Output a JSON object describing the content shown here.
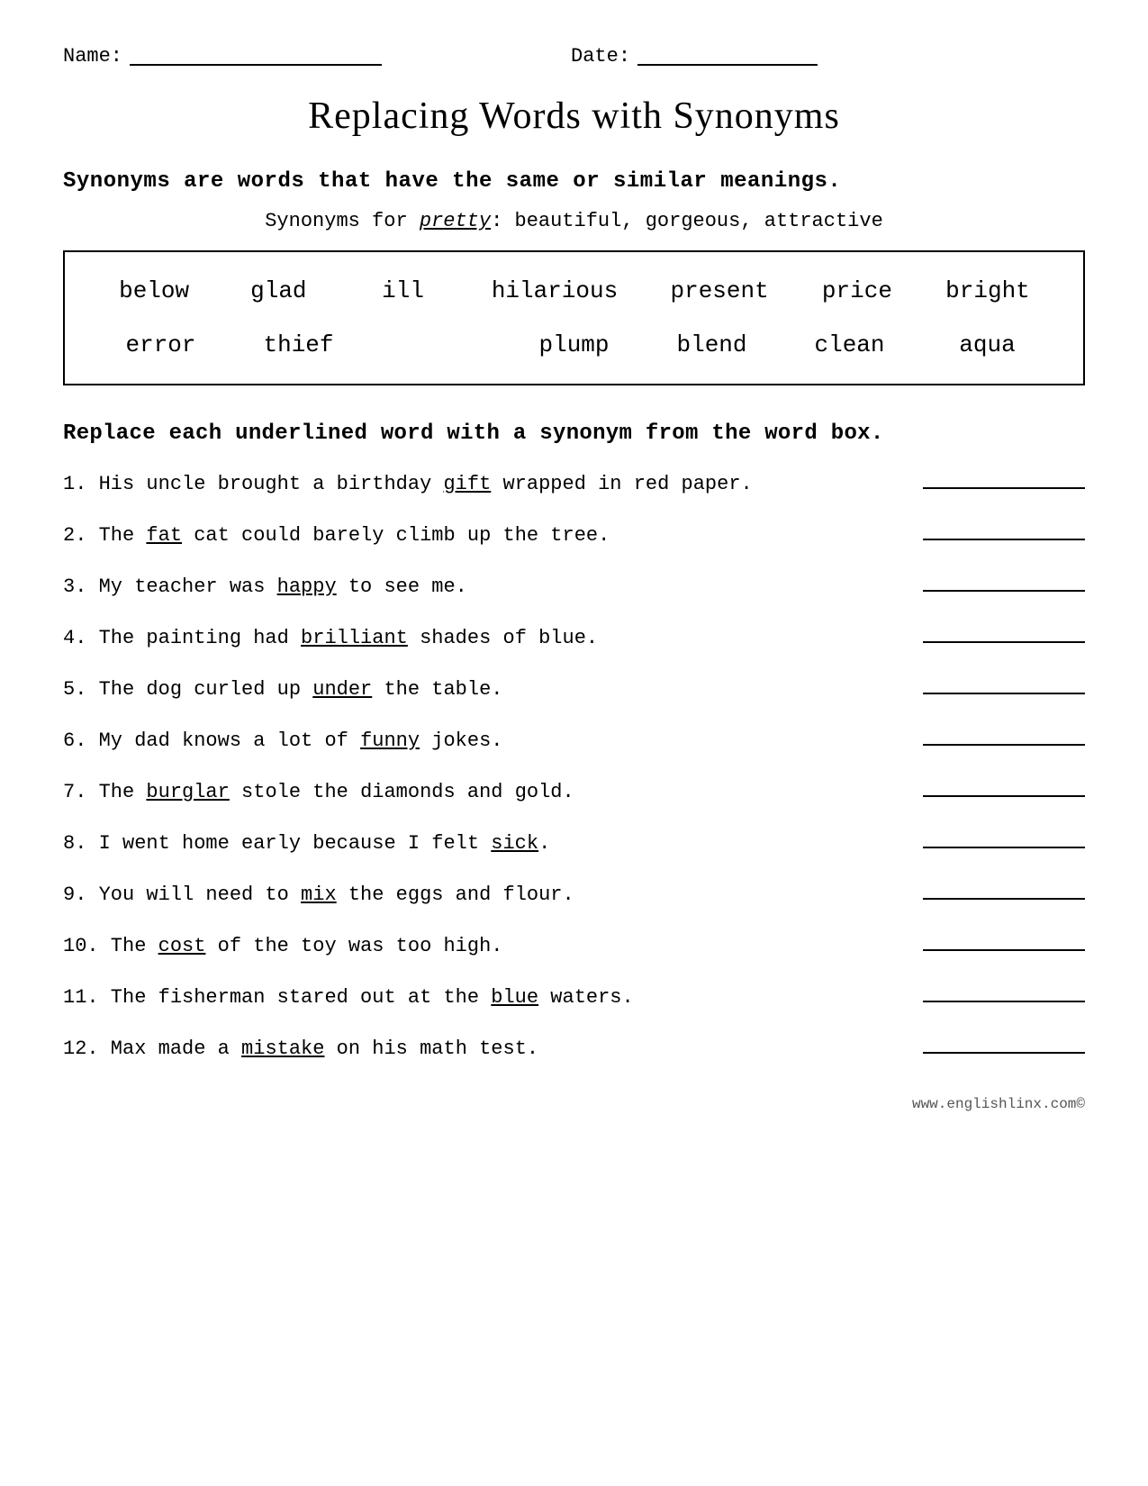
{
  "header": {
    "name_label": "Name:",
    "date_label": "Date:"
  },
  "title": "Replacing Words with Synonyms",
  "definition": {
    "text": "Synonyms are words that have the same or similar meanings."
  },
  "example": {
    "prefix": "Synonyms for ",
    "word": "pretty",
    "suffix": ": beautiful, gorgeous, attractive"
  },
  "word_box": {
    "row1": [
      "below",
      "glad",
      "ill",
      "hilarious",
      "present",
      "price",
      "bright"
    ],
    "row2": [
      "error",
      "thief",
      "",
      "plump",
      "blend",
      "clean",
      "aqua"
    ]
  },
  "instruction": "Replace each underlined word with a synonym from the word box.",
  "exercises": [
    {
      "number": "1.",
      "text_parts": [
        "His uncle brought a birthday ",
        "gift",
        " wrapped in red paper."
      ],
      "underlined_index": 1
    },
    {
      "number": "2.",
      "text_parts": [
        "The ",
        "fat",
        " cat could barely climb up the tree."
      ],
      "underlined_index": 1
    },
    {
      "number": "3.",
      "text_parts": [
        "My teacher was ",
        "happy",
        " to see me."
      ],
      "underlined_index": 1
    },
    {
      "number": "4.",
      "text_parts": [
        "The painting had ",
        "brilliant",
        " shades of blue."
      ],
      "underlined_index": 1
    },
    {
      "number": "5.",
      "text_parts": [
        "The dog curled up ",
        "under",
        " the table."
      ],
      "underlined_index": 1
    },
    {
      "number": "6.",
      "text_parts": [
        "My dad knows a lot of ",
        "funny",
        " jokes."
      ],
      "underlined_index": 1
    },
    {
      "number": "7.",
      "text_parts": [
        "The ",
        "burglar",
        " stole the diamonds and gold."
      ],
      "underlined_index": 1
    },
    {
      "number": "8.",
      "text_parts": [
        "I went home early because I felt ",
        "sick",
        "."
      ],
      "underlined_index": 1
    },
    {
      "number": "9.",
      "text_parts": [
        "You will need to ",
        "mix",
        " the eggs and flour."
      ],
      "underlined_index": 1
    },
    {
      "number": "10.",
      "text_parts": [
        "The ",
        "cost",
        " of the toy was too high."
      ],
      "underlined_index": 1
    },
    {
      "number": "11.",
      "text_parts": [
        "The fisherman stared out at the ",
        "blue",
        " waters."
      ],
      "underlined_index": 1
    },
    {
      "number": "12.",
      "text_parts": [
        "Max made a ",
        "mistake",
        " on his math test."
      ],
      "underlined_index": 1
    }
  ],
  "footer": {
    "text": "www.englishlinx.com©"
  }
}
